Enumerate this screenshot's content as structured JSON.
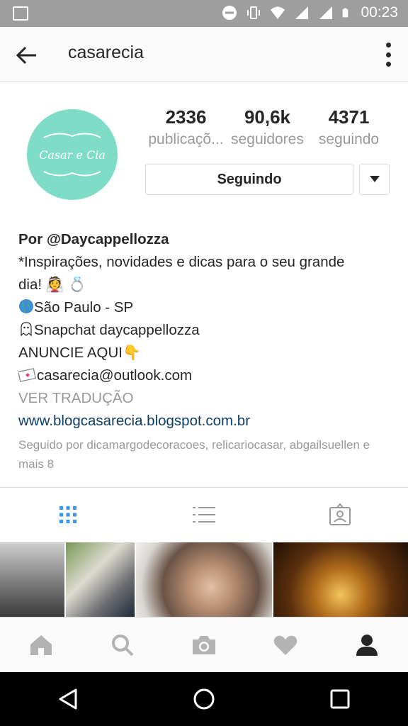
{
  "status_bar": {
    "time": "00:23",
    "icons": [
      "image-icon",
      "do-not-disturb-icon",
      "vibrate-icon",
      "wifi-icon",
      "signal-icon",
      "signal-icon",
      "battery-icon"
    ]
  },
  "app_bar": {
    "title": "casarecia",
    "back_icon": "arrow-back-icon",
    "more_icon": "more-vertical-icon"
  },
  "profile": {
    "avatar_text": "Casar e Cia",
    "avatar_color": "#7fdcc7",
    "stats": [
      {
        "value": "2336",
        "label": "publicaçõ..."
      },
      {
        "value": "90,6k",
        "label": "seguidores"
      },
      {
        "value": "4371",
        "label": "seguindo"
      }
    ],
    "follow_button": "Seguindo"
  },
  "bio": {
    "name": "Por @Daycappellozza",
    "lines": [
      "*Inspirações, novidades e dicas para o seu grande",
      "dia! 👰 💍",
      "São Paulo - SP",
      "Snapchat daycappellozza",
      "ANUNCIE AQUI👇",
      "casarecia@outlook.com"
    ],
    "translate": "VER TRADUÇÃO",
    "website": "www.blogcasarecia.blogspot.com.br",
    "followed_by": "Seguido por dicamargodecoracoes, relicariocasar, abgailsuellen e mais 8"
  },
  "tabs": [
    "grid-icon",
    "list-icon",
    "tagged-icon"
  ],
  "bottom_nav": [
    "home-icon",
    "search-icon",
    "camera-icon",
    "heart-icon",
    "profile-icon"
  ],
  "system_nav": [
    "back-triangle-icon",
    "home-circle-icon",
    "recents-square-icon"
  ],
  "colors": {
    "accent": "#3897f0",
    "link": "#0e3e66",
    "status_bar": "#9e9e9e"
  }
}
